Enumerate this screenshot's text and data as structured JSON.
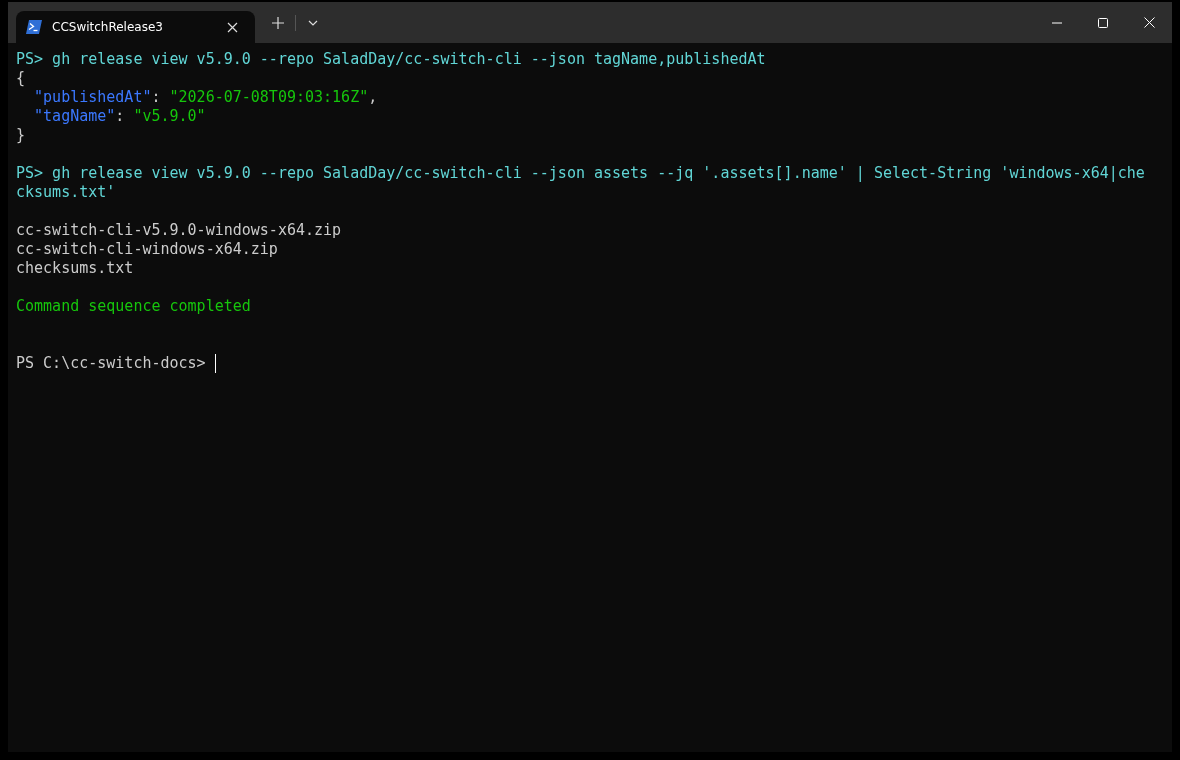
{
  "tab": {
    "title": "CCSwitchRelease3",
    "selected": true
  },
  "lines": [
    {
      "kind": "text",
      "spans": [
        {
          "kind": "command",
          "text": "PS> gh release view v5.9.0 --repo SaladDay/cc-switch-cli --json tagName,publishedAt"
        }
      ]
    },
    {
      "kind": "text",
      "spans": [
        {
          "kind": "plain",
          "text": "{"
        }
      ]
    },
    {
      "kind": "text",
      "indented": true,
      "spans": [
        {
          "kind": "key",
          "text": "\"publishedAt\""
        },
        {
          "kind": "plain",
          "text": ": "
        },
        {
          "kind": "string",
          "text": "\"2026-07-08T09:03:16Z\""
        },
        {
          "kind": "plain",
          "text": ","
        }
      ]
    },
    {
      "kind": "text",
      "indented": true,
      "spans": [
        {
          "kind": "key",
          "text": "\"tagName\""
        },
        {
          "kind": "plain",
          "text": ": "
        },
        {
          "kind": "string",
          "text": "\"v5.9.0\""
        }
      ]
    },
    {
      "kind": "text",
      "spans": [
        {
          "kind": "plain",
          "text": "}"
        }
      ]
    },
    {
      "kind": "blank"
    },
    {
      "kind": "text",
      "spans": [
        {
          "kind": "command",
          "text": "PS> gh release view v5.9.0 --repo SaladDay/cc-switch-cli --json assets --jq '.assets[].name' | Select-String 'windows-x64|che"
        }
      ]
    },
    {
      "kind": "text",
      "spans": [
        {
          "kind": "command",
          "text": "cksums.txt'"
        }
      ]
    },
    {
      "kind": "blank"
    },
    {
      "kind": "text",
      "spans": [
        {
          "kind": "plain",
          "text": "cc-switch-cli-v5.9.0-windows-x64.zip"
        }
      ]
    },
    {
      "kind": "text",
      "spans": [
        {
          "kind": "plain",
          "text": "cc-switch-cli-windows-x64.zip"
        }
      ]
    },
    {
      "kind": "text",
      "spans": [
        {
          "kind": "plain",
          "text": "checksums.txt"
        }
      ]
    },
    {
      "kind": "blank"
    },
    {
      "kind": "text",
      "spans": [
        {
          "kind": "success",
          "text": "Command sequence completed"
        }
      ]
    },
    {
      "kind": "blank"
    },
    {
      "kind": "blank"
    }
  ],
  "prompt": "PS C:\\cc-switch-docs> "
}
